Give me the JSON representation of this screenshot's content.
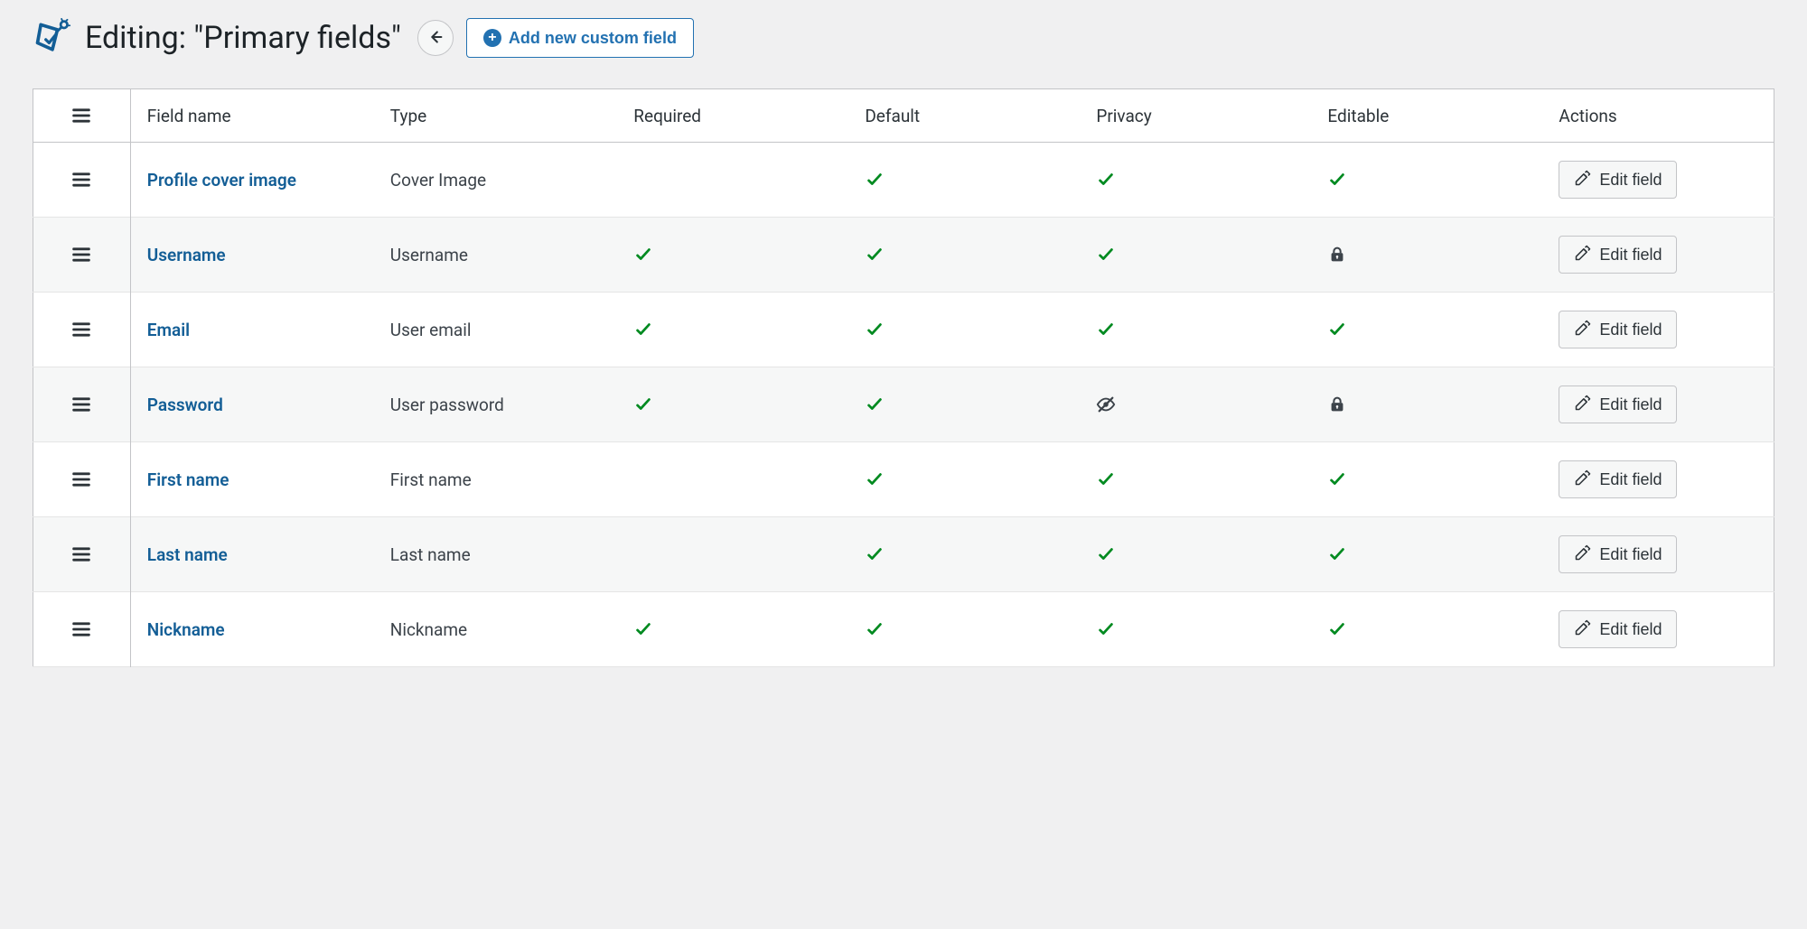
{
  "header": {
    "title": "Editing: \"Primary fields\"",
    "add_button_label": "Add new custom field"
  },
  "columns": {
    "name": "Field name",
    "type": "Type",
    "required": "Required",
    "default": "Default",
    "privacy": "Privacy",
    "editable": "Editable",
    "actions": "Actions"
  },
  "action_labels": {
    "edit": "Edit field"
  },
  "rows": [
    {
      "name": "Profile cover image",
      "type": "Cover Image",
      "required": "",
      "default": "check",
      "privacy": "check",
      "editable": "check",
      "action": "edit"
    },
    {
      "name": "Username",
      "type": "Username",
      "required": "check",
      "default": "check",
      "privacy": "check",
      "editable": "lock",
      "action": "edit"
    },
    {
      "name": "Email",
      "type": "User email",
      "required": "check",
      "default": "check",
      "privacy": "check",
      "editable": "check",
      "action": "edit"
    },
    {
      "name": "Password",
      "type": "User password",
      "required": "check",
      "default": "check",
      "privacy": "eye-off",
      "editable": "lock",
      "action": "edit"
    },
    {
      "name": "First name",
      "type": "First name",
      "required": "",
      "default": "check",
      "privacy": "check",
      "editable": "check",
      "action": "edit"
    },
    {
      "name": "Last name",
      "type": "Last name",
      "required": "",
      "default": "check",
      "privacy": "check",
      "editable": "check",
      "action": "edit"
    },
    {
      "name": "Nickname",
      "type": "Nickname",
      "required": "check",
      "default": "check",
      "privacy": "check",
      "editable": "check",
      "action": "edit"
    }
  ]
}
